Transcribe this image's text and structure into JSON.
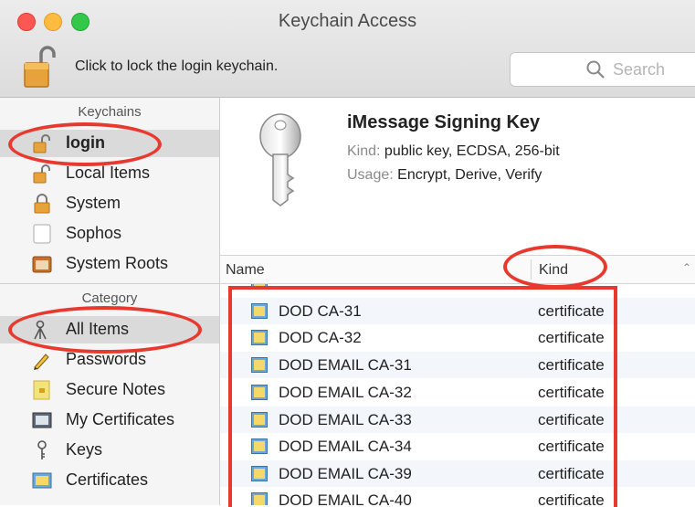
{
  "window": {
    "title": "Keychain Access"
  },
  "toolbar": {
    "lock_text": "Click to lock the login keychain.",
    "search_placeholder": "Search"
  },
  "sidebar": {
    "keychains_header": "Keychains",
    "keychains": [
      {
        "label": "login",
        "icon": "unlocked-padlock-icon",
        "selected": true
      },
      {
        "label": "Local Items",
        "icon": "unlocked-padlock-icon"
      },
      {
        "label": "System",
        "icon": "locked-padlock-icon"
      },
      {
        "label": "Sophos",
        "icon": "blank-keychain-icon"
      },
      {
        "label": "System Roots",
        "icon": "folder-keychain-icon"
      }
    ],
    "category_header": "Category",
    "categories": [
      {
        "label": "All Items",
        "icon": "all-items-icon",
        "selected": true
      },
      {
        "label": "Passwords",
        "icon": "password-pencil-icon"
      },
      {
        "label": "Secure Notes",
        "icon": "secure-note-icon"
      },
      {
        "label": "My Certificates",
        "icon": "my-certificate-icon"
      },
      {
        "label": "Keys",
        "icon": "key-icon"
      },
      {
        "label": "Certificates",
        "icon": "certificate-icon"
      }
    ]
  },
  "detail": {
    "title": "iMessage Signing Key",
    "kind_label": "Kind:",
    "kind_value": "public key, ECDSA, 256-bit",
    "usage_label": "Usage:",
    "usage_value": "Encrypt, Derive, Verify"
  },
  "table": {
    "columns": {
      "name": "Name",
      "kind": "Kind"
    },
    "rows": [
      {
        "name": "DOD CA-31",
        "kind": "certificate"
      },
      {
        "name": "DOD CA-32",
        "kind": "certificate"
      },
      {
        "name": "DOD EMAIL CA-31",
        "kind": "certificate"
      },
      {
        "name": "DOD EMAIL CA-32",
        "kind": "certificate"
      },
      {
        "name": "DOD EMAIL CA-33",
        "kind": "certificate"
      },
      {
        "name": "DOD EMAIL CA-34",
        "kind": "certificate"
      },
      {
        "name": "DOD EMAIL CA-39",
        "kind": "certificate"
      },
      {
        "name": "DOD EMAIL CA-40",
        "kind": "certificate"
      }
    ]
  },
  "colors": {
    "annotation": "#e8392f",
    "selection": "#dadada",
    "accent": "#f0a020"
  }
}
